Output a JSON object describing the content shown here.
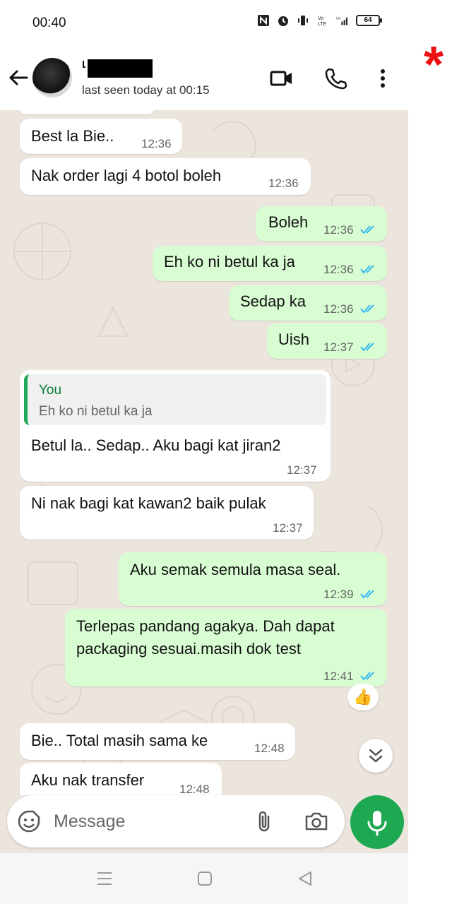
{
  "status_bar": {
    "time": "00:40",
    "battery": "64"
  },
  "header": {
    "last_seen": "last seen today at 00:15"
  },
  "messages": [
    {
      "direction": "in",
      "text": "Best la Bie..",
      "time": "12:36"
    },
    {
      "direction": "in",
      "text": "Nak order lagi 4 botol boleh",
      "time": "12:36"
    },
    {
      "direction": "out",
      "text": "Boleh",
      "time": "12:36",
      "status": "read"
    },
    {
      "direction": "out",
      "text": "Eh ko ni betul ka ja",
      "time": "12:36",
      "status": "read"
    },
    {
      "direction": "out",
      "text": "Sedap ka",
      "time": "12:36",
      "status": "read"
    },
    {
      "direction": "out",
      "text": "Uish",
      "time": "12:37",
      "status": "read"
    },
    {
      "direction": "in",
      "quote_author": "You",
      "quote_text": "Eh ko ni betul ka ja",
      "text": "Betul la.. Sedap.. Aku bagi kat jiran2",
      "time": "12:37"
    },
    {
      "direction": "in",
      "text": "Ni nak bagi kat kawan2 baik pulak",
      "time": "12:37"
    },
    {
      "direction": "out",
      "text": "Aku semak semula masa seal.",
      "time": "12:39",
      "status": "read"
    },
    {
      "direction": "out",
      "text_line1": "Terlepas pandang agakya. Dah dapat",
      "text_line2": "packaging sesuai.masih dok test",
      "time": "12:41",
      "status": "read",
      "reaction": "👍"
    },
    {
      "direction": "in",
      "text": "Bie.. Total masih sama ke",
      "time": "12:48"
    },
    {
      "direction": "in",
      "text": "Aku nak transfer",
      "time": "12:48"
    }
  ],
  "input": {
    "placeholder": "Message"
  },
  "marker": "*",
  "colors": {
    "outgoing_bubble": "#d9fdd3",
    "incoming_bubble": "#ffffff",
    "accent_green": "#1da851",
    "read_ticks": "#34b7f1"
  },
  "icons": {
    "back": "arrow-left-icon",
    "video": "video-call-icon",
    "phone": "phone-icon",
    "more": "more-vertical-icon",
    "emoji": "emoji-sticker-icon",
    "attach": "paperclip-icon",
    "camera": "camera-icon",
    "mic": "microphone-icon",
    "scroll": "double-chevron-down-icon"
  }
}
